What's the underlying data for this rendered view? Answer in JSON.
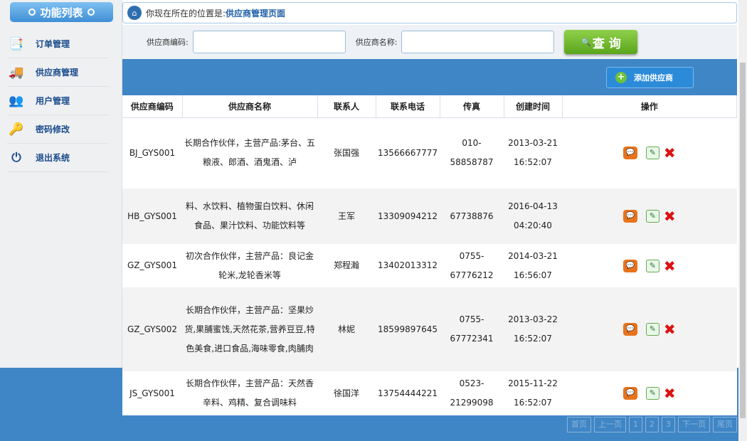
{
  "sidebar": {
    "title": "功能列表",
    "items": [
      {
        "label": "订单管理",
        "icon": "📑"
      },
      {
        "label": "供应商管理",
        "icon": "🚚"
      },
      {
        "label": "用户管理",
        "icon": "👥"
      },
      {
        "label": "密码修改",
        "icon": "🔑"
      },
      {
        "label": "退出系统",
        "icon": "⏻"
      }
    ]
  },
  "breadcrumb": {
    "prefix": "你现在所在的位置是:",
    "current": "供应商管理页面"
  },
  "search": {
    "code_label": "供应商编码:",
    "name_label": "供应商名称:",
    "query_label": "查 询"
  },
  "toolbar": {
    "add_label": "添加供应商"
  },
  "table": {
    "columns": [
      "供应商编码",
      "供应商名称",
      "联系人",
      "联系电话",
      "传真",
      "创建时间",
      "操作"
    ],
    "rows": [
      {
        "code": "BJ_GYS001",
        "name": "长期合作伙伴，主营产品:茅台、五粮液、郎酒、酒鬼酒、泸",
        "contact": "张国强",
        "phone": "13566667777",
        "fax": "010-58858787",
        "time": "2013-03-21 16:52:07"
      },
      {
        "code": "HB_GYS001",
        "name": "料、水饮料、植物蛋白饮料、休闲食品、果汁饮料、功能饮料等",
        "contact": "王军",
        "phone": "13309094212",
        "fax": "67738876",
        "time": "2016-04-13 04:20:40"
      },
      {
        "code": "GZ_GYS001",
        "name": "初次合作伙伴，主营产品：良记金轮米,龙轮香米等",
        "contact": "郑程瀚",
        "phone": "13402013312",
        "fax": "0755-67776212",
        "time": "2014-03-21 16:56:07"
      },
      {
        "code": "GZ_GYS002",
        "name": "长期合作伙伴，主营产品：坚果炒货,果脯蜜饯,天然花茶,营养豆豆,特色美食,进口食品,海味零食,肉脯肉",
        "contact": "林妮",
        "phone": "18599897645",
        "fax": "0755-67772341",
        "time": "2013-03-22 16:52:07"
      },
      {
        "code": "JS_GYS001",
        "name": "长期合作伙伴，主营产品：天然香辛料、鸡精、复合调味料",
        "contact": "徐国洋",
        "phone": "13754444221",
        "fax": "0523-21299098",
        "time": "2015-11-22 16:52:07"
      }
    ]
  },
  "pager": [
    "首页",
    "上一页",
    "1",
    "2",
    "3",
    "下一页",
    "尾页"
  ]
}
